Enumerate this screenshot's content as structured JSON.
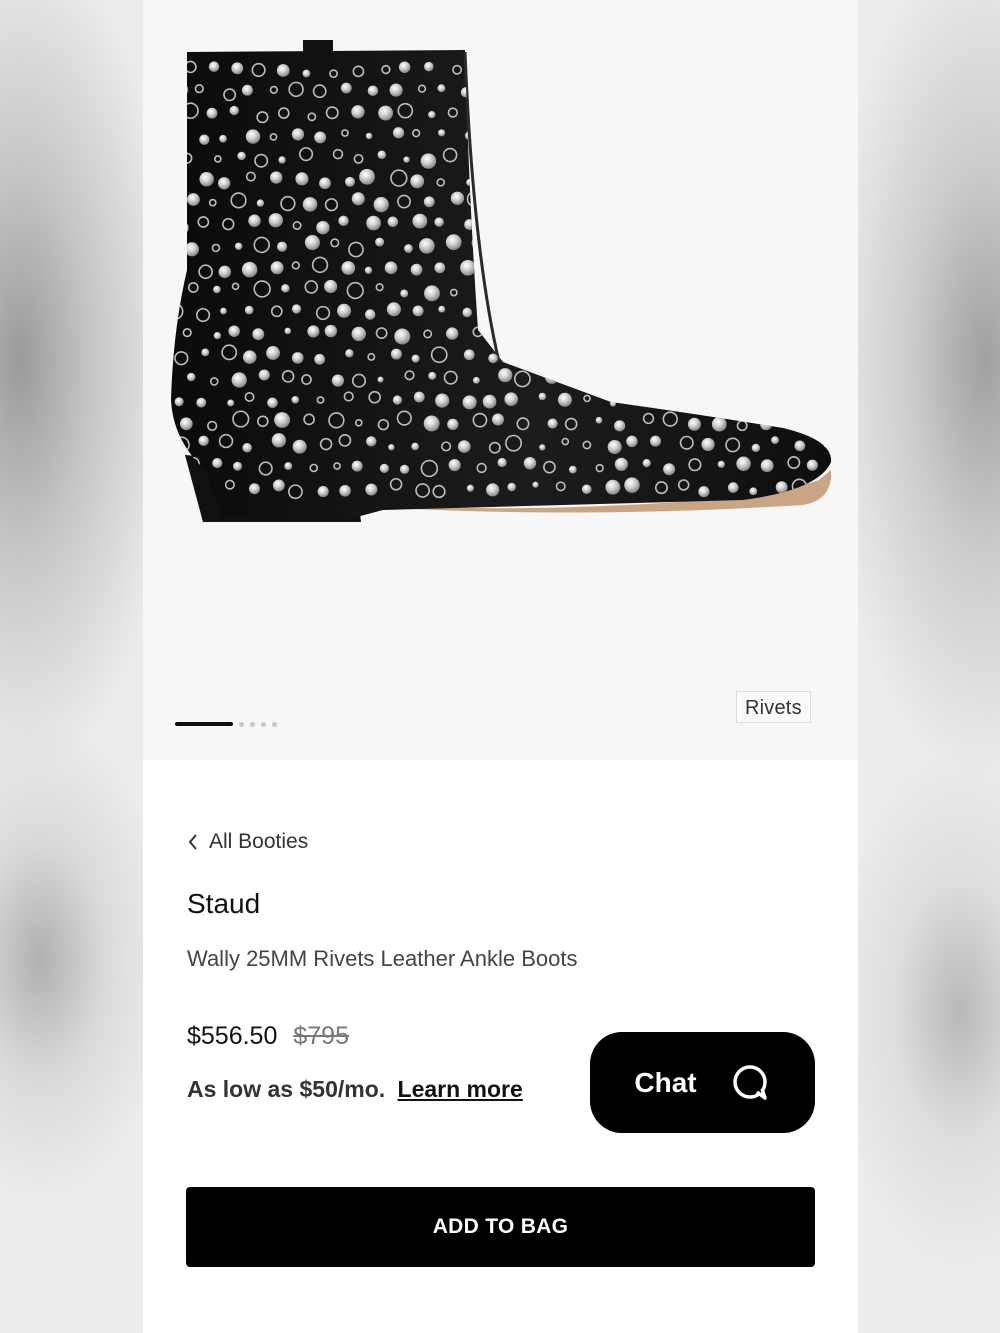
{
  "gallery": {
    "product_image": "studded-black-leather-ankle-boot",
    "variant_tag": "Rivets",
    "image_count": 5,
    "active_index": 0
  },
  "breadcrumb": {
    "label": "All Booties",
    "icon": "chevron-left-icon"
  },
  "product": {
    "brand": "Staud",
    "name": "Wally 25MM Rivets Leather Ankle Boots"
  },
  "pricing": {
    "sale_price": "$556.50",
    "original_price": "$795",
    "financing_text": "As low as $50/mo.",
    "learn_more": "Learn more"
  },
  "chat": {
    "label": "Chat",
    "icon": "chat-bubble-icon"
  },
  "cta": {
    "add_to_bag": "ADD TO BAG"
  },
  "colors": {
    "accent": "#000000",
    "background": "#f7f7f7"
  }
}
